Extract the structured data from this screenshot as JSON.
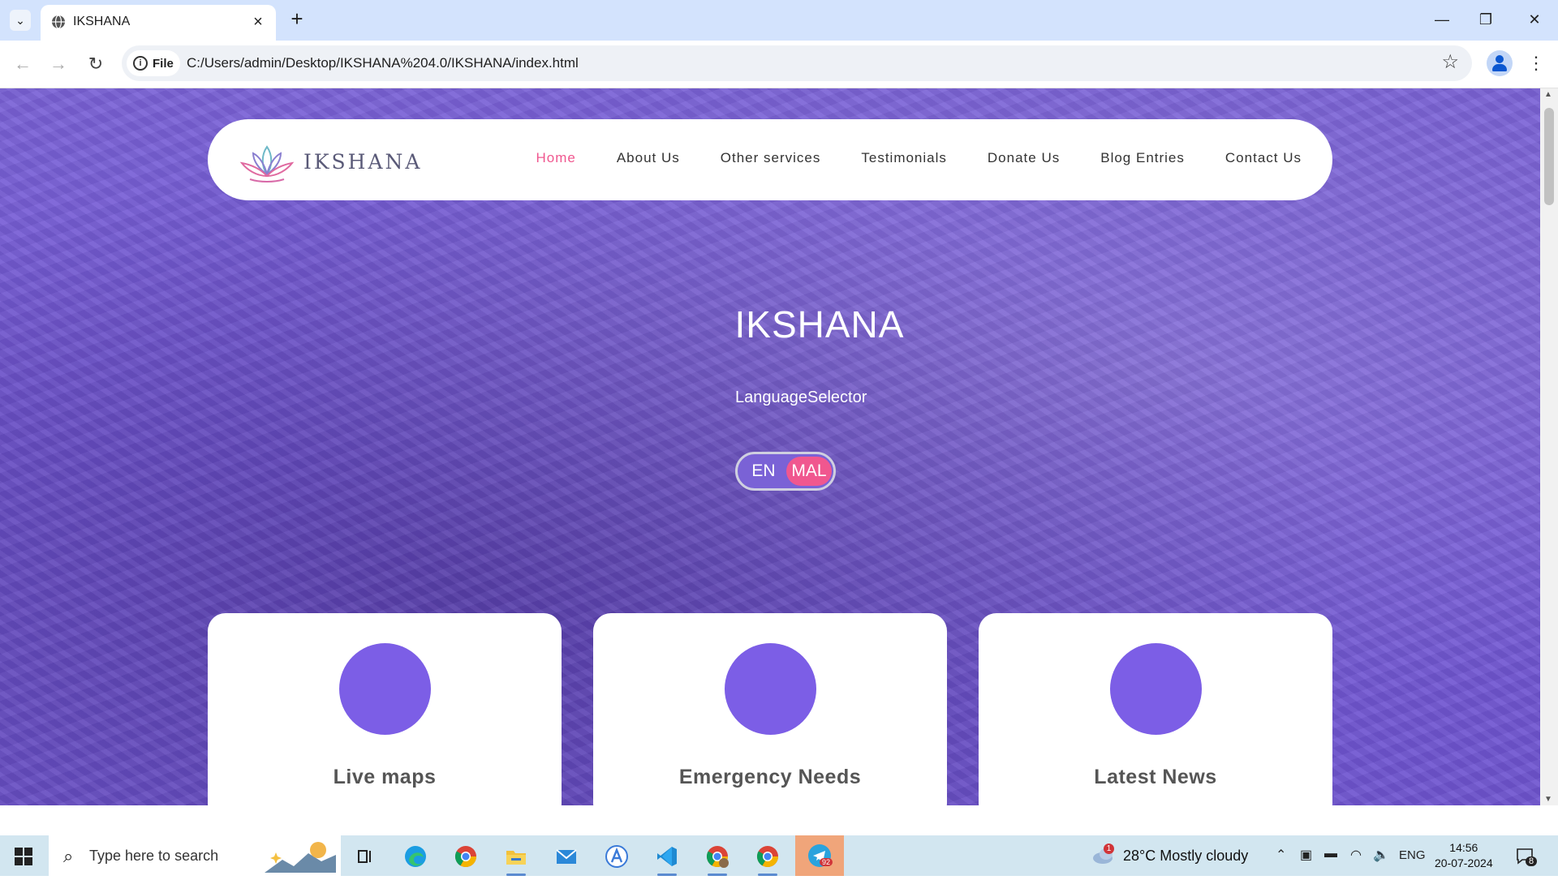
{
  "browser": {
    "tab_title": "IKSHANA",
    "file_chip_label": "File",
    "url": "C:/Users/admin/Desktop/IKSHANA%204.0/IKSHANA/index.html"
  },
  "site": {
    "brand": "IKSHANA",
    "nav": [
      "Home",
      "About Us",
      "Other services",
      "Testimonials",
      "Donate Us",
      "Blog Entries",
      "Contact Us"
    ],
    "active_nav": "Home",
    "hero_title": "IKSHANA",
    "language_label": "LanguageSelector",
    "lang_en": "EN",
    "lang_mal": "MAL",
    "selected_lang": "MAL",
    "cards": [
      "Live maps",
      "Emergency Needs",
      "Latest News"
    ]
  },
  "colors": {
    "hero_overlay": "#7a62d6",
    "accent_pink": "#f0578f",
    "card_circle": "#7c5ee6"
  },
  "taskbar": {
    "search_placeholder": "Type here to search",
    "weather_badge": "1",
    "weather": "28°C  Mostly cloudy",
    "lang": "ENG",
    "time": "14:56",
    "date": "20-07-2024",
    "telegram_badge": "92",
    "notifications": "8"
  },
  "icons": [
    "tab-search-icon",
    "globe-icon",
    "close-icon",
    "new-tab-icon",
    "minimize-icon",
    "restore-icon",
    "window-close-icon",
    "back-icon",
    "forward-icon",
    "reload-icon",
    "info-icon",
    "bookmark-star-icon",
    "profile-icon",
    "menu-icon",
    "windows-start-icon",
    "search-icon",
    "task-view-icon",
    "edge-icon",
    "chrome-icon",
    "file-explorer-icon",
    "mail-icon",
    "app-store-icon",
    "vscode-icon",
    "telegram-icon",
    "weather-icon",
    "chevron-up-icon",
    "network-icon",
    "battery-icon",
    "wifi-icon",
    "volume-icon",
    "notification-icon"
  ]
}
